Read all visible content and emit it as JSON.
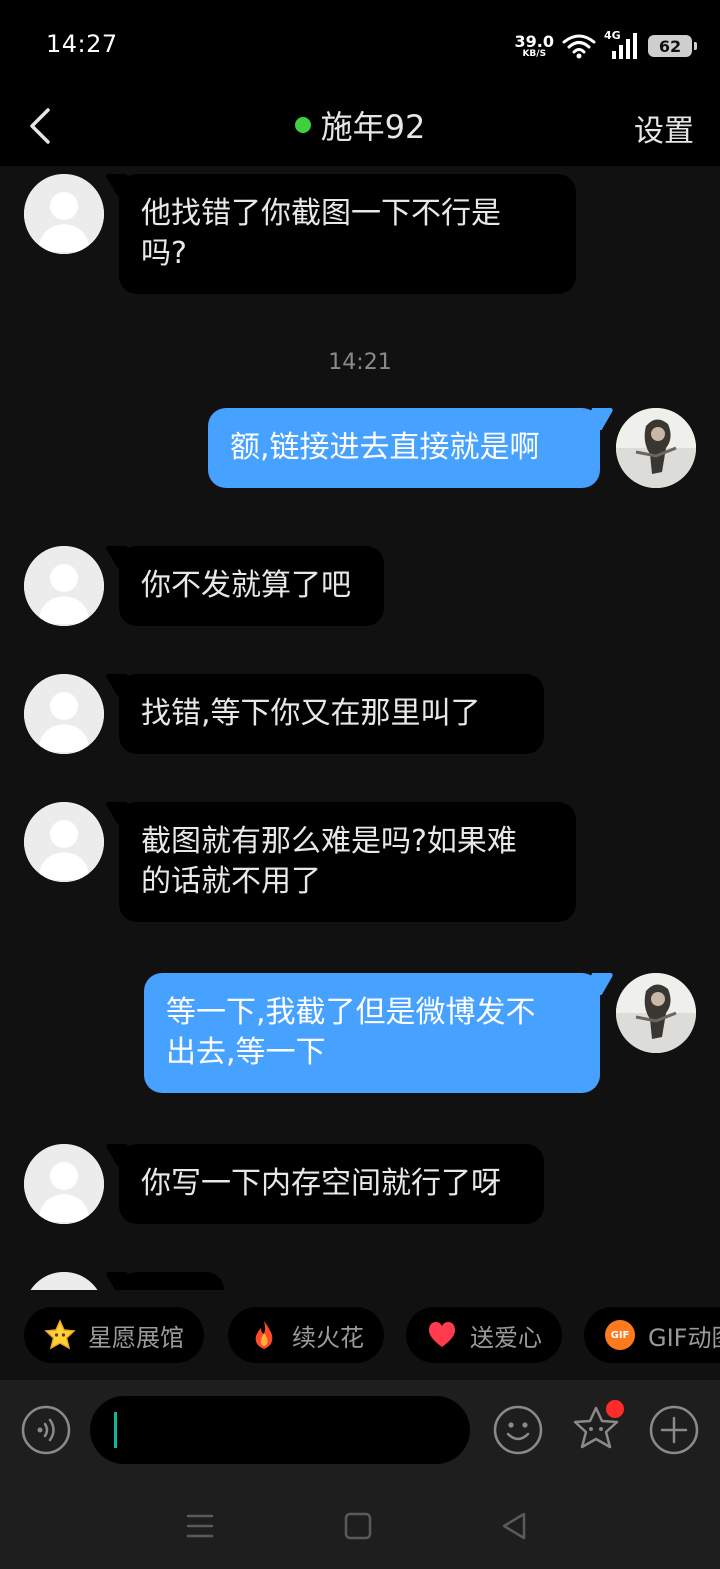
{
  "status_bar": {
    "time": "14:27",
    "net_speed": "39.0",
    "net_unit": "KB/S",
    "signal_type": "4G",
    "battery": "62"
  },
  "header": {
    "title": "施年92",
    "settings_label": "设置",
    "online_color": "#3fcf3f"
  },
  "messages": [
    {
      "side": "in",
      "text_lines": [
        "他找错了你截图一下不行是",
        "吗?"
      ]
    },
    {
      "timestamp": "14:21"
    },
    {
      "side": "out",
      "text_lines": [
        "额,链接进去直接就是啊"
      ]
    },
    {
      "side": "in",
      "text_lines": [
        "你不发就算了吧"
      ]
    },
    {
      "side": "in",
      "text_lines": [
        "找错,等下你又在那里叫了"
      ]
    },
    {
      "side": "in",
      "text_lines": [
        "截图就有那么难是吗?如果难",
        "的话就不用了"
      ]
    },
    {
      "side": "out",
      "text_lines": [
        "等一下,我截了但是微博发不",
        "出去,等一下"
      ]
    },
    {
      "side": "in",
      "text_lines": [
        "你写一下内存空间就行了呀"
      ]
    }
  ],
  "chips": [
    {
      "label": "星愿展馆",
      "icon": "star-icon"
    },
    {
      "label": "续火花",
      "icon": "flame-icon"
    },
    {
      "label": "送爱心",
      "icon": "heart-icon"
    },
    {
      "label": "GIF动图",
      "icon": "gif-icon",
      "icon_text": "GIF"
    }
  ],
  "colors": {
    "outgoing_bubble": "#46a1ff",
    "incoming_bubble": "#000000",
    "background": "#111111"
  }
}
